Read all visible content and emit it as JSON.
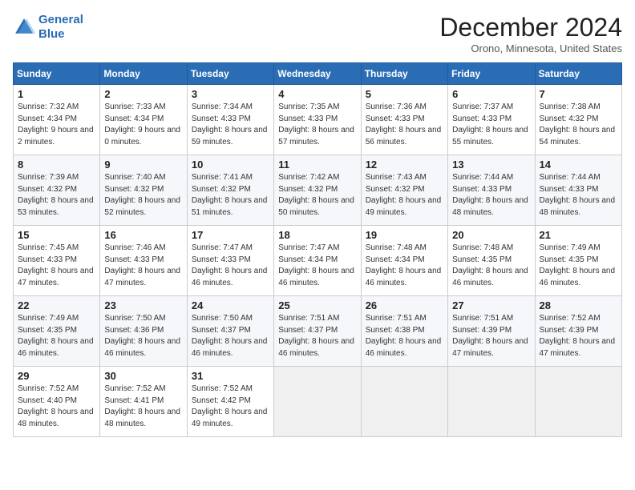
{
  "header": {
    "logo_line1": "General",
    "logo_line2": "Blue",
    "month": "December 2024",
    "location": "Orono, Minnesota, United States"
  },
  "weekdays": [
    "Sunday",
    "Monday",
    "Tuesday",
    "Wednesday",
    "Thursday",
    "Friday",
    "Saturday"
  ],
  "weeks": [
    [
      {
        "day": "1",
        "sunrise": "Sunrise: 7:32 AM",
        "sunset": "Sunset: 4:34 PM",
        "daylight": "Daylight: 9 hours and 2 minutes."
      },
      {
        "day": "2",
        "sunrise": "Sunrise: 7:33 AM",
        "sunset": "Sunset: 4:34 PM",
        "daylight": "Daylight: 9 hours and 0 minutes."
      },
      {
        "day": "3",
        "sunrise": "Sunrise: 7:34 AM",
        "sunset": "Sunset: 4:33 PM",
        "daylight": "Daylight: 8 hours and 59 minutes."
      },
      {
        "day": "4",
        "sunrise": "Sunrise: 7:35 AM",
        "sunset": "Sunset: 4:33 PM",
        "daylight": "Daylight: 8 hours and 57 minutes."
      },
      {
        "day": "5",
        "sunrise": "Sunrise: 7:36 AM",
        "sunset": "Sunset: 4:33 PM",
        "daylight": "Daylight: 8 hours and 56 minutes."
      },
      {
        "day": "6",
        "sunrise": "Sunrise: 7:37 AM",
        "sunset": "Sunset: 4:33 PM",
        "daylight": "Daylight: 8 hours and 55 minutes."
      },
      {
        "day": "7",
        "sunrise": "Sunrise: 7:38 AM",
        "sunset": "Sunset: 4:32 PM",
        "daylight": "Daylight: 8 hours and 54 minutes."
      }
    ],
    [
      {
        "day": "8",
        "sunrise": "Sunrise: 7:39 AM",
        "sunset": "Sunset: 4:32 PM",
        "daylight": "Daylight: 8 hours and 53 minutes."
      },
      {
        "day": "9",
        "sunrise": "Sunrise: 7:40 AM",
        "sunset": "Sunset: 4:32 PM",
        "daylight": "Daylight: 8 hours and 52 minutes."
      },
      {
        "day": "10",
        "sunrise": "Sunrise: 7:41 AM",
        "sunset": "Sunset: 4:32 PM",
        "daylight": "Daylight: 8 hours and 51 minutes."
      },
      {
        "day": "11",
        "sunrise": "Sunrise: 7:42 AM",
        "sunset": "Sunset: 4:32 PM",
        "daylight": "Daylight: 8 hours and 50 minutes."
      },
      {
        "day": "12",
        "sunrise": "Sunrise: 7:43 AM",
        "sunset": "Sunset: 4:32 PM",
        "daylight": "Daylight: 8 hours and 49 minutes."
      },
      {
        "day": "13",
        "sunrise": "Sunrise: 7:44 AM",
        "sunset": "Sunset: 4:33 PM",
        "daylight": "Daylight: 8 hours and 48 minutes."
      },
      {
        "day": "14",
        "sunrise": "Sunrise: 7:44 AM",
        "sunset": "Sunset: 4:33 PM",
        "daylight": "Daylight: 8 hours and 48 minutes."
      }
    ],
    [
      {
        "day": "15",
        "sunrise": "Sunrise: 7:45 AM",
        "sunset": "Sunset: 4:33 PM",
        "daylight": "Daylight: 8 hours and 47 minutes."
      },
      {
        "day": "16",
        "sunrise": "Sunrise: 7:46 AM",
        "sunset": "Sunset: 4:33 PM",
        "daylight": "Daylight: 8 hours and 47 minutes."
      },
      {
        "day": "17",
        "sunrise": "Sunrise: 7:47 AM",
        "sunset": "Sunset: 4:33 PM",
        "daylight": "Daylight: 8 hours and 46 minutes."
      },
      {
        "day": "18",
        "sunrise": "Sunrise: 7:47 AM",
        "sunset": "Sunset: 4:34 PM",
        "daylight": "Daylight: 8 hours and 46 minutes."
      },
      {
        "day": "19",
        "sunrise": "Sunrise: 7:48 AM",
        "sunset": "Sunset: 4:34 PM",
        "daylight": "Daylight: 8 hours and 46 minutes."
      },
      {
        "day": "20",
        "sunrise": "Sunrise: 7:48 AM",
        "sunset": "Sunset: 4:35 PM",
        "daylight": "Daylight: 8 hours and 46 minutes."
      },
      {
        "day": "21",
        "sunrise": "Sunrise: 7:49 AM",
        "sunset": "Sunset: 4:35 PM",
        "daylight": "Daylight: 8 hours and 46 minutes."
      }
    ],
    [
      {
        "day": "22",
        "sunrise": "Sunrise: 7:49 AM",
        "sunset": "Sunset: 4:35 PM",
        "daylight": "Daylight: 8 hours and 46 minutes."
      },
      {
        "day": "23",
        "sunrise": "Sunrise: 7:50 AM",
        "sunset": "Sunset: 4:36 PM",
        "daylight": "Daylight: 8 hours and 46 minutes."
      },
      {
        "day": "24",
        "sunrise": "Sunrise: 7:50 AM",
        "sunset": "Sunset: 4:37 PM",
        "daylight": "Daylight: 8 hours and 46 minutes."
      },
      {
        "day": "25",
        "sunrise": "Sunrise: 7:51 AM",
        "sunset": "Sunset: 4:37 PM",
        "daylight": "Daylight: 8 hours and 46 minutes."
      },
      {
        "day": "26",
        "sunrise": "Sunrise: 7:51 AM",
        "sunset": "Sunset: 4:38 PM",
        "daylight": "Daylight: 8 hours and 46 minutes."
      },
      {
        "day": "27",
        "sunrise": "Sunrise: 7:51 AM",
        "sunset": "Sunset: 4:39 PM",
        "daylight": "Daylight: 8 hours and 47 minutes."
      },
      {
        "day": "28",
        "sunrise": "Sunrise: 7:52 AM",
        "sunset": "Sunset: 4:39 PM",
        "daylight": "Daylight: 8 hours and 47 minutes."
      }
    ],
    [
      {
        "day": "29",
        "sunrise": "Sunrise: 7:52 AM",
        "sunset": "Sunset: 4:40 PM",
        "daylight": "Daylight: 8 hours and 48 minutes."
      },
      {
        "day": "30",
        "sunrise": "Sunrise: 7:52 AM",
        "sunset": "Sunset: 4:41 PM",
        "daylight": "Daylight: 8 hours and 48 minutes."
      },
      {
        "day": "31",
        "sunrise": "Sunrise: 7:52 AM",
        "sunset": "Sunset: 4:42 PM",
        "daylight": "Daylight: 8 hours and 49 minutes."
      },
      null,
      null,
      null,
      null
    ]
  ]
}
